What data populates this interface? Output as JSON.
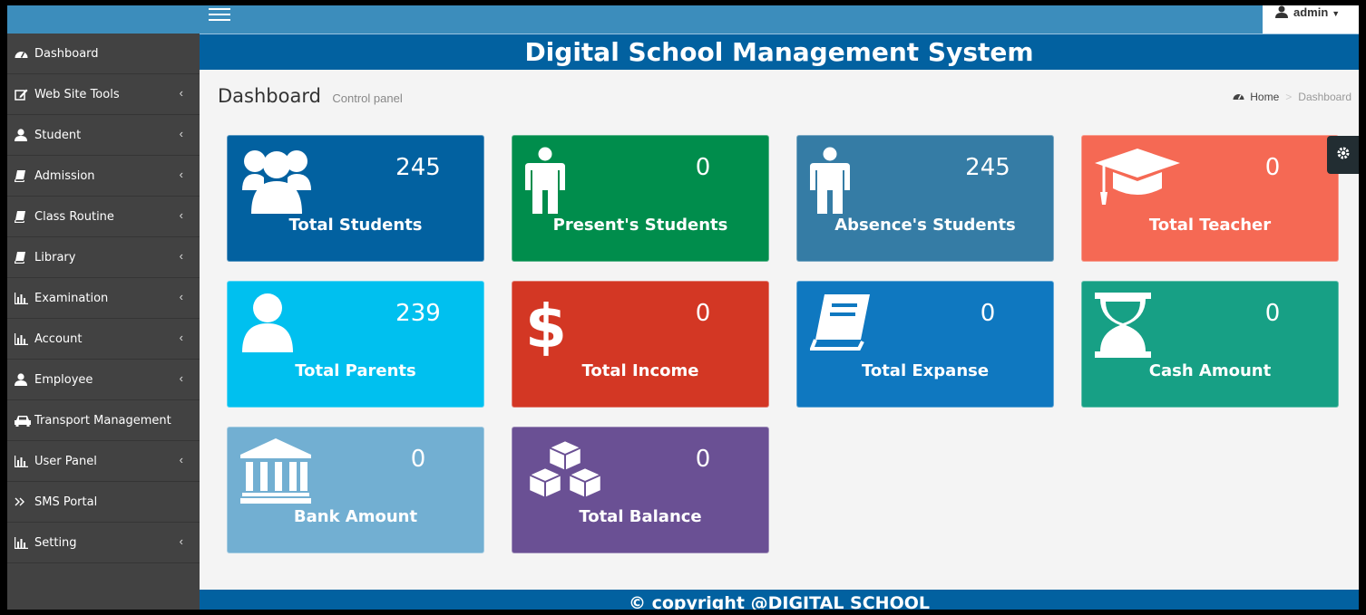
{
  "topbar": {
    "user": "admin"
  },
  "banner": {
    "title": "Digital School Management System"
  },
  "header": {
    "title": "Dashboard",
    "subtitle": "Control panel"
  },
  "breadcrumb": {
    "home": "Home",
    "current": "Dashboard"
  },
  "sidebar": {
    "items": [
      {
        "label": "Dashboard",
        "icon": "dashboard-icon",
        "submenu": false
      },
      {
        "label": "Web Site Tools",
        "icon": "edit-icon",
        "submenu": true
      },
      {
        "label": "Student",
        "icon": "user-icon",
        "submenu": true
      },
      {
        "label": "Admission",
        "icon": "book-icon",
        "submenu": true
      },
      {
        "label": "Class Routine",
        "icon": "book-icon",
        "submenu": true
      },
      {
        "label": "Library",
        "icon": "book-icon",
        "submenu": true
      },
      {
        "label": "Examination",
        "icon": "bar-chart-icon",
        "submenu": true
      },
      {
        "label": "Account",
        "icon": "bar-chart-icon",
        "submenu": true
      },
      {
        "label": "Employee",
        "icon": "user-icon",
        "submenu": true
      },
      {
        "label": "Transport Management",
        "icon": "car-icon",
        "submenu": false
      },
      {
        "label": "User Panel",
        "icon": "bar-chart-icon",
        "submenu": true
      },
      {
        "label": "SMS Portal",
        "icon": "double-chevron-icon",
        "submenu": false
      },
      {
        "label": "Setting",
        "icon": "bar-chart-icon",
        "submenu": true
      }
    ]
  },
  "cards": [
    {
      "label": "Total Students",
      "value": "245",
      "color": "#0261a0",
      "icon": "users-group-icon"
    },
    {
      "label": "Present's Students",
      "value": "0",
      "color": "#008d4c",
      "icon": "male-figure-icon"
    },
    {
      "label": "Absence's Students",
      "value": "245",
      "color": "#357ca5",
      "icon": "male-figure-icon"
    },
    {
      "label": "Total Teacher",
      "value": "0",
      "color": "#f56954",
      "icon": "graduation-cap-icon"
    },
    {
      "label": "Total Parents",
      "value": "239",
      "color": "#00c0ef",
      "icon": "user-icon"
    },
    {
      "label": "Total Income",
      "value": "0",
      "color": "#d33724",
      "icon": "dollar-icon"
    },
    {
      "label": "Total Expanse",
      "value": "0",
      "color": "#0f78c0",
      "icon": "book-icon"
    },
    {
      "label": "Cash Amount",
      "value": "0",
      "color": "#17a085",
      "icon": "hourglass-icon"
    },
    {
      "label": "Bank Amount",
      "value": "0",
      "color": "#72afd2",
      "icon": "bank-icon"
    },
    {
      "label": "Total Balance",
      "value": "0",
      "color": "#6a5094",
      "icon": "cubes-icon"
    }
  ],
  "footer": {
    "text": "© copyright @DIGITAL SCHOOL"
  }
}
